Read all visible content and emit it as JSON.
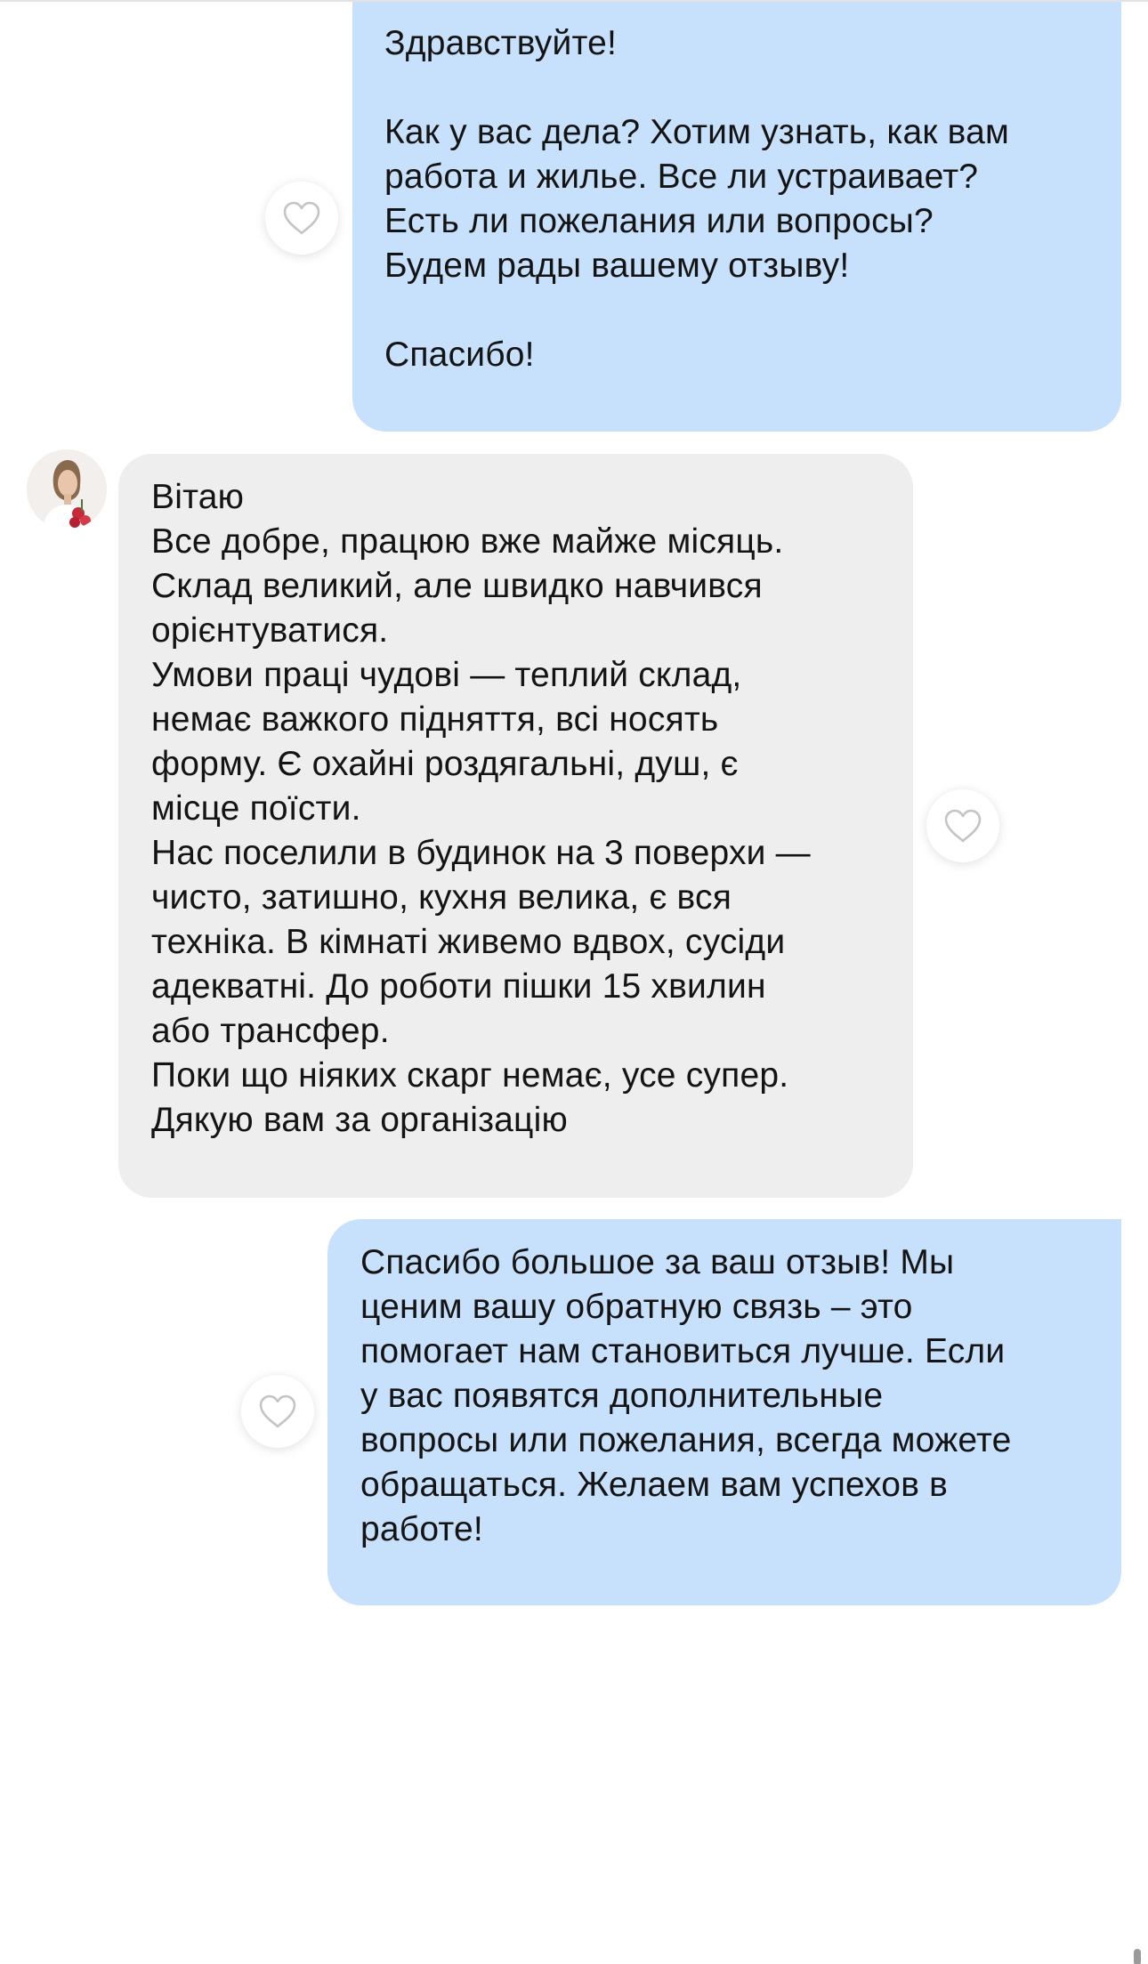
{
  "messages": [
    {
      "direction": "outgoing",
      "text": "Здравствуйте!\n\nКак у вас дела? Хотим узнать, как вам\nработа и жилье. Все ли устраивает?\nЕсть ли пожелания или вопросы?\nБудем рады вашему отзыву!\n\nСпасибо!",
      "like_icon": "heart-outline-icon"
    },
    {
      "direction": "incoming",
      "text": "Вітаю\nВсе добре, працюю вже майже місяць.\nСклад великий, але швидко навчився\nорієнтуватися.\nУмови праці чудові — теплий склад,\nнемає важкого підняття, всі носять\nформу. Є охайні роздягальні, душ, є\nмісце поїсти.\nНас поселили в будинок на 3 поверхи —\nчисто, затишно, кухня велика, є вся\nтехніка. В кімнаті живемо вдвох, сусіди\nадекватні. До роботи пішки 15 хвилин\nабо трансфер.\nПоки що ніяких скарг немає, усе супер.\nДякую вам за організацію",
      "like_icon": "heart-outline-icon",
      "avatar": "user-avatar"
    },
    {
      "direction": "outgoing",
      "text": "Спасибо большое за ваш отзыв! Мы\nценим вашу обратную связь – это\nпомогает нам становиться лучше. Если\nу вас появятся дополнительные\nвопросы или пожелания, всегда можете\nобращаться. Желаем вам успехов в\nработе!",
      "like_icon": "heart-outline-icon"
    }
  ],
  "colors": {
    "outgoing_bubble": "#c7e0fb",
    "incoming_bubble": "#eeeeee",
    "text": "#141414",
    "heart_stroke": "#c4c4c6"
  }
}
